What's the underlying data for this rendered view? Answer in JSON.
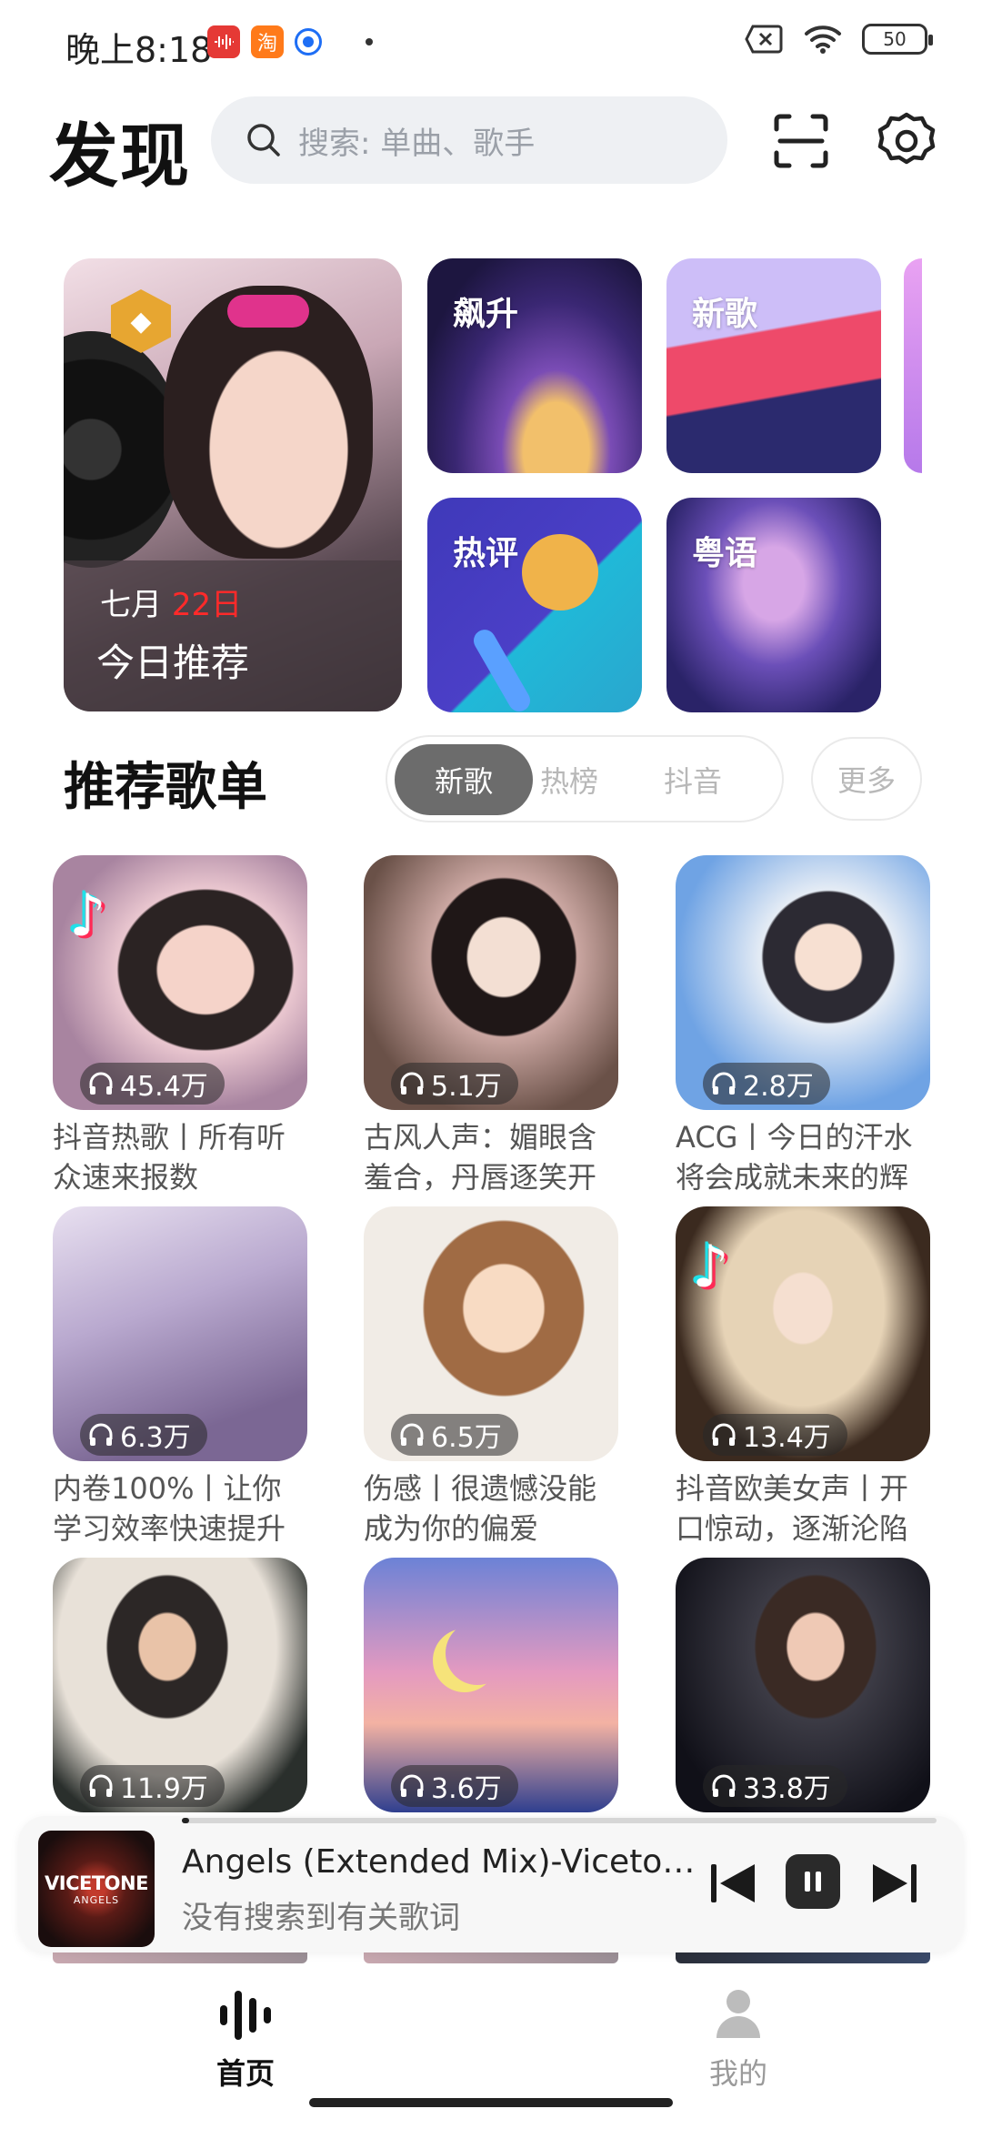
{
  "status_bar": {
    "time": "晚上8:18",
    "app_icons": [
      "sound-wave-app-icon",
      "taobao-app-icon",
      "browser-app-icon"
    ],
    "taobao_glyph": "淘",
    "battery": "50"
  },
  "header": {
    "title": "发现",
    "search_placeholder": "搜索: 单曲、歌手"
  },
  "featured": {
    "today": {
      "month": "七月",
      "day": "22日",
      "label": "今日推荐"
    },
    "cards": [
      {
        "label": "飙升"
      },
      {
        "label": "新歌"
      },
      {
        "label": "热评"
      },
      {
        "label": "粤语"
      }
    ]
  },
  "playlists_section": {
    "title": "推荐歌单",
    "tabs": [
      "新歌",
      "热榜",
      "抖音"
    ],
    "active_tab": "新歌",
    "more": "更多",
    "items": [
      {
        "plays": "45.4万",
        "title": "抖音热歌丨所有听众速来报数"
      },
      {
        "plays": "5.1万",
        "title": "古风人声：媚眼含羞合，丹唇逐笑开"
      },
      {
        "plays": "2.8万",
        "title": "ACG丨今日的汗水将会成就未来的辉"
      },
      {
        "plays": "6.3万",
        "title": "内卷100%丨让你学习效率快速提升"
      },
      {
        "plays": "6.5万",
        "title": "伤感丨很遗憾没能成为你的偏爱"
      },
      {
        "plays": "13.4万",
        "title": "抖音欧美女声丨开口惊动，逐渐沦陷"
      },
      {
        "plays": "11.9万",
        "title": ""
      },
      {
        "plays": "3.6万",
        "title": ""
      },
      {
        "plays": "33.8万",
        "title": ""
      }
    ]
  },
  "player": {
    "album_text": "VICETONE",
    "album_sub": "ANGELS",
    "track": "Angels (Extended Mix)-Vicetone...",
    "lyric": "没有搜索到有关歌词",
    "progress": 0.01
  },
  "bottom_nav": {
    "items": [
      {
        "label": "首页",
        "active": true
      },
      {
        "label": "我的",
        "active": false
      }
    ]
  },
  "colors": {
    "accent": "#6c6c6c",
    "date_highlight": "#ff2a2a",
    "search_bg": "#eef0f3"
  }
}
